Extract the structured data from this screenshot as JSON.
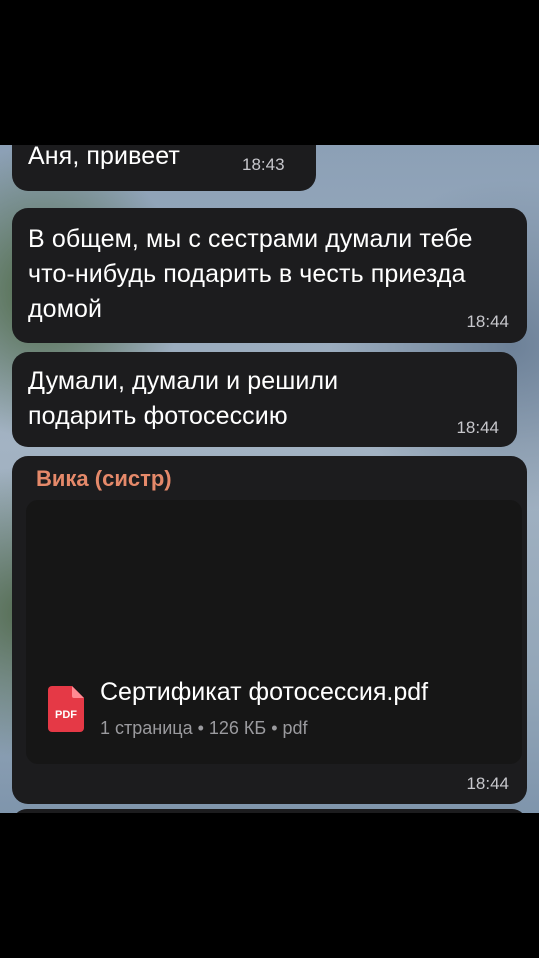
{
  "messages": [
    {
      "text": "Аня, привеет",
      "time": "18:43"
    },
    {
      "text": "В общем, мы с сестрами думали тебе что-нибудь подарить в честь приезда домой",
      "time": "18:44"
    },
    {
      "text": "Думали, думали и решили подарить фотосессию",
      "time": "18:44"
    }
  ],
  "file_message": {
    "sender": "Вика (систр)",
    "file_name": "Сертификат фотосессия.pdf",
    "meta": "1 страница • 126 КБ • pdf",
    "icon_label": "PDF",
    "time": "18:44"
  },
  "colors": {
    "bubble": "#1c1c1e",
    "sender_name": "#e5896a",
    "pdf_icon": "#e53946"
  }
}
